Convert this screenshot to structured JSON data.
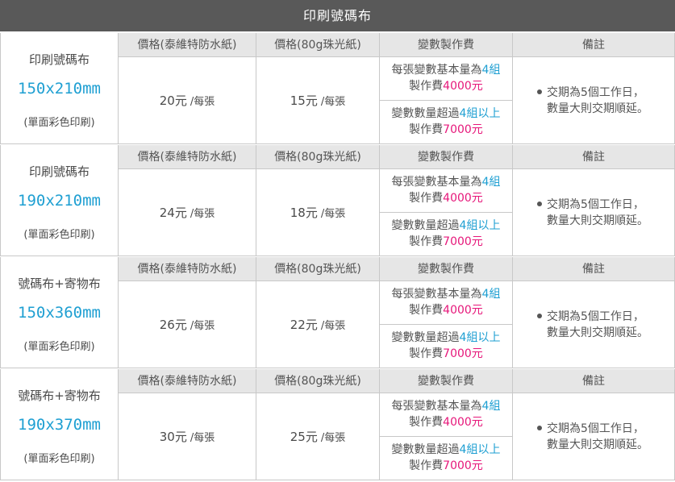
{
  "title": "印刷號碼布",
  "headers": {
    "price_waterproof": "價格(泰維特防水紙)",
    "price_pearl": "價格(80g珠光紙)",
    "variable_fee": "變數製作費",
    "remarks": "備註"
  },
  "price_unit": "/每張",
  "variable": {
    "line1_prefix": "每張變數基本量為",
    "line1_highlight": "4組",
    "line2_prefix": "製作費",
    "line2_highlight": "4000元",
    "line3_prefix": "變數數量超過",
    "line3_highlight": "4組以上",
    "line4_prefix": "製作費",
    "line4_highlight": "7000元"
  },
  "remarks": {
    "line1": "交期為5個工作日，",
    "line2": "數量大則交期順延。"
  },
  "products": [
    {
      "name": "印刷號碼布",
      "size": "150x210mm",
      "note": "(單面彩色印刷)",
      "price_waterproof": "20元",
      "price_pearl": "15元"
    },
    {
      "name": "印刷號碼布",
      "size": "190x210mm",
      "note": "(單面彩色印刷)",
      "price_waterproof": "24元",
      "price_pearl": "18元"
    },
    {
      "name": "號碼布+寄物布",
      "size": "150x360mm",
      "note": "(單面彩色印刷)",
      "price_waterproof": "26元",
      "price_pearl": "22元"
    },
    {
      "name": "號碼布+寄物布",
      "size": "190x370mm",
      "note": "(單面彩色印刷)",
      "price_waterproof": "30元",
      "price_pearl": "25元"
    }
  ]
}
